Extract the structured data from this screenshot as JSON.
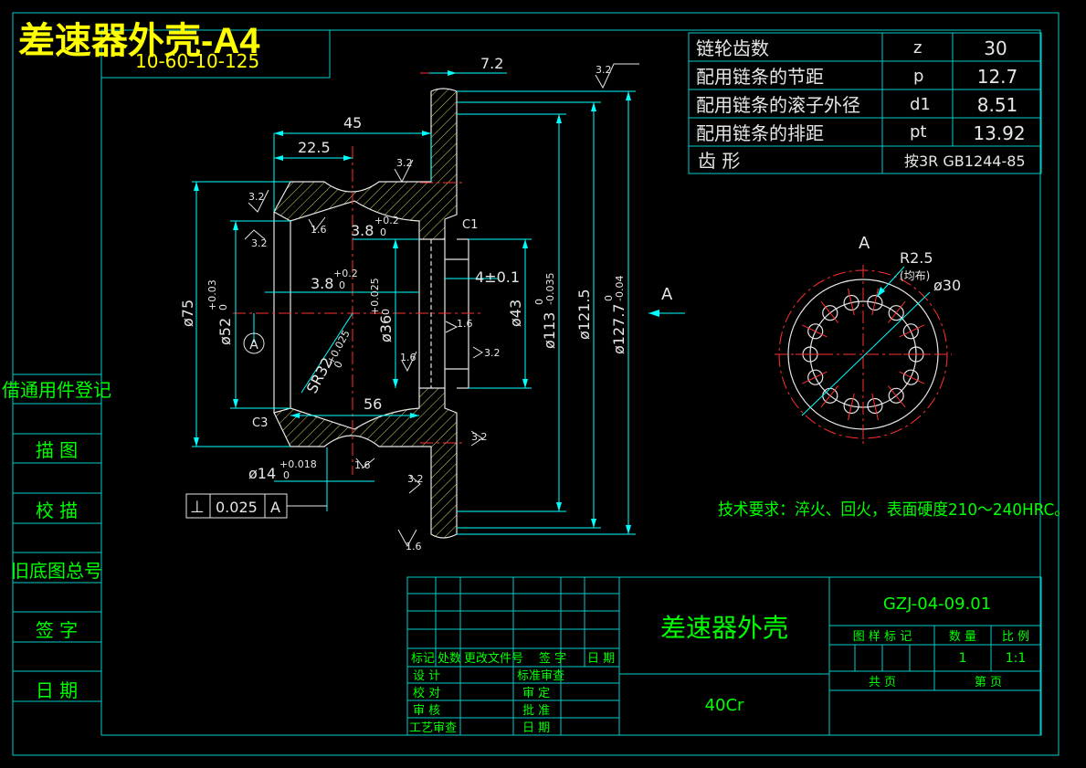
{
  "sheet_title": "差速器外壳-A4",
  "top_left_code": "10-60-10-125",
  "side_column": [
    "借通用件登记",
    "描 图",
    "校 描",
    "旧底图总号",
    "签 字",
    "日 期"
  ],
  "chain_table": [
    {
      "label": "链轮齿数",
      "sym": "z",
      "val": "30"
    },
    {
      "label": "配用链条的节距",
      "sym": "p",
      "val": "12.7"
    },
    {
      "label": "配用链条的滚子外径",
      "sym": "d1",
      "val": "8.51"
    },
    {
      "label": "配用链条的排距",
      "sym": "pt",
      "val": "13.92"
    }
  ],
  "tooth_form": {
    "label": "齿 形",
    "value": "按3R GB1244-85"
  },
  "dimensions": {
    "d7_2": "7.2",
    "d45": "45",
    "d22_5": "22.5",
    "d3_8a_base": "3.8",
    "d3_8a_tol_u": "+0.2",
    "d3_8a_tol_l": "0",
    "d3_8b_base": "3.8",
    "d3_8b_tol_u": "+0.2",
    "d3_8b_tol_l": "0",
    "d4": "4±0.1",
    "d56": "56",
    "phi75": "ø75",
    "phi52_base": "ø52",
    "phi52_u": "+0.03",
    "phi52_l": "0",
    "phi36_base": "ø36",
    "phi36_u": "+0.025",
    "phi36_l": "0",
    "sr32_base": "SR32",
    "sr32_u": "+0.025",
    "sr32_l": "0",
    "phi43": "ø43",
    "phi113_base": "ø113",
    "phi113_u": "0",
    "phi113_l": "-0.035",
    "phi121_5": "ø121.5",
    "phi127_base": "ø127.7",
    "phi127_u": "0",
    "phi127_l": "-0.04",
    "phi14_base": "ø14",
    "phi14_u": "+0.018",
    "phi14_l": "0",
    "c1": "C1",
    "c3": "C3",
    "rough_3_2": "3.2",
    "rough_1_6": "1.6",
    "datum": "A",
    "r2_5": "R2.5",
    "r2_5_note": "(均布)",
    "phi30": "ø30",
    "section_view": "A",
    "arrow_label": "A"
  },
  "tolerance_frame": {
    "symbol": "⊥",
    "value": "0.025",
    "datum": "A"
  },
  "tech_requirement": "技术要求：淬火、回火，表面硬度210～240HRC。",
  "title_block": {
    "part_name": "差速器外壳",
    "drawing_no": "GZJ-04-09.01",
    "material": "40Cr",
    "hdr_mark": "图 样 标 记",
    "hdr_qty": "数 量",
    "hdr_scale": "比 例",
    "qty": "1",
    "scale": "1:1",
    "total_sheets": "共 页",
    "sheet_no": "第 页",
    "rev_headers": [
      "标记",
      "处数",
      "更改文件号",
      "签 字",
      "日 期"
    ],
    "left_roles": [
      "设 计",
      "校 对",
      "审 核",
      "工艺审查"
    ],
    "mid_roles": [
      "标准审查",
      "审 定",
      "批 准",
      "日 期"
    ]
  }
}
